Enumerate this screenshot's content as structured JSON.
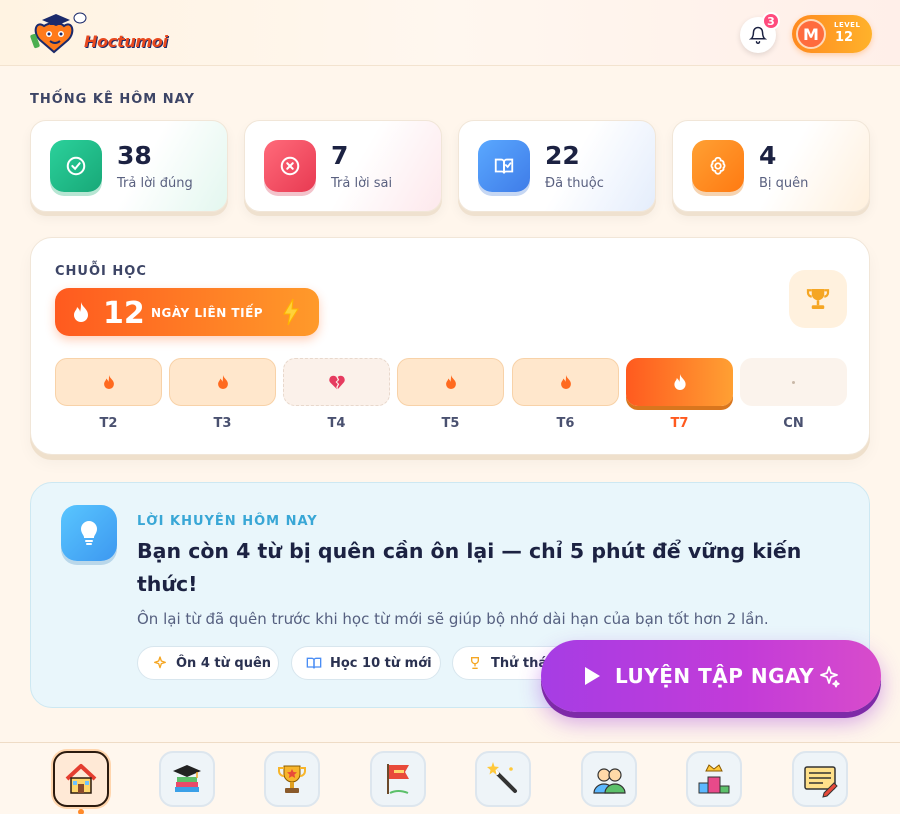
{
  "header": {
    "logo_text": "Hoctumoi",
    "notifications_count": "3",
    "avatar_initial": "M",
    "level_label": "LEVEL",
    "level_value": "12"
  },
  "stats": {
    "title": "THỐNG KÊ HÔM NAY",
    "items": [
      {
        "value": "38",
        "label": "Trả lời đúng",
        "icon": "check-circle-icon",
        "color": "#1fb98a"
      },
      {
        "value": "7",
        "label": "Trả lời sai",
        "icon": "x-circle-icon",
        "color": "#f04b5e"
      },
      {
        "value": "22",
        "label": "Đã thuộc",
        "icon": "book-check-icon",
        "color": "#4a8df4"
      },
      {
        "value": "4",
        "label": "Bị quên",
        "icon": "brain-icon",
        "color": "#ff8c1a"
      }
    ]
  },
  "streak": {
    "title": "CHUỖI HỌC",
    "count": "12",
    "count_label": "NGÀY LIÊN TIẾP",
    "days": [
      {
        "label": "T2",
        "status": "done"
      },
      {
        "label": "T3",
        "status": "done"
      },
      {
        "label": "T4",
        "status": "missed"
      },
      {
        "label": "T5",
        "status": "done"
      },
      {
        "label": "T6",
        "status": "done"
      },
      {
        "label": "T7",
        "status": "today"
      },
      {
        "label": "CN",
        "status": "upcoming"
      }
    ]
  },
  "tip": {
    "label": "LỜI KHUYÊN HÔM NAY",
    "heading": "Bạn còn 4 từ bị quên cần ôn lại — chỉ 5 phút để vững kiến thức!",
    "body": "Ôn lại từ đã quên trước khi học từ mới sẽ giúp bộ nhớ dài hạn của bạn tốt hơn 2 lần.",
    "chips": [
      {
        "label": "Ôn 4 từ quên",
        "icon": "sparkle-icon"
      },
      {
        "label": "Học 10 từ mới",
        "icon": "book-open-icon"
      },
      {
        "label": "Thử thá",
        "icon": "trophy-icon"
      }
    ]
  },
  "cta": {
    "label": "LUYỆN TẬP NGAY"
  },
  "bottom_nav": [
    {
      "name": "home",
      "icon": "house-icon",
      "active": true
    },
    {
      "name": "courses",
      "icon": "graduation-books-icon"
    },
    {
      "name": "achievements",
      "icon": "trophy-icon"
    },
    {
      "name": "goals",
      "icon": "flag-icon"
    },
    {
      "name": "magic",
      "icon": "magic-wand-icon"
    },
    {
      "name": "friends",
      "icon": "people-icon"
    },
    {
      "name": "leaderboard",
      "icon": "podium-icon"
    },
    {
      "name": "notes",
      "icon": "notepad-icon"
    }
  ],
  "colors": {
    "primary_orange": "#ff6a1f",
    "purple_cta": "#b13ee0",
    "tip_blue": "#39a7d6",
    "background": "#fff6ec"
  }
}
